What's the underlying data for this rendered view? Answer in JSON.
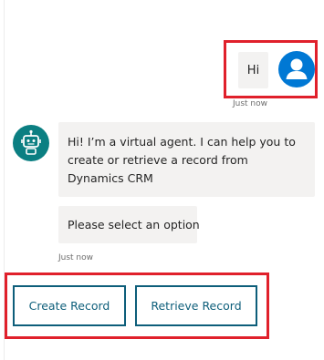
{
  "user_message": {
    "text": "Hi",
    "timestamp": "Just now"
  },
  "bot_messages": [
    {
      "text": "Hi! I’m a virtual agent. I can help you to create or retrieve a record from Dynamics CRM"
    },
    {
      "text": "Please select an option"
    }
  ],
  "bot_timestamp": "Just now",
  "suggested_actions": [
    {
      "label": "Create Record"
    },
    {
      "label": "Retrieve Record"
    }
  ],
  "colors": {
    "highlight": "#e0202b",
    "user_avatar": "#0078d4",
    "bot_avatar": "#0b7f82",
    "button_border": "#0d5e7a"
  },
  "icons": {
    "user_avatar": "person-icon",
    "bot_avatar": "bot-icon"
  }
}
